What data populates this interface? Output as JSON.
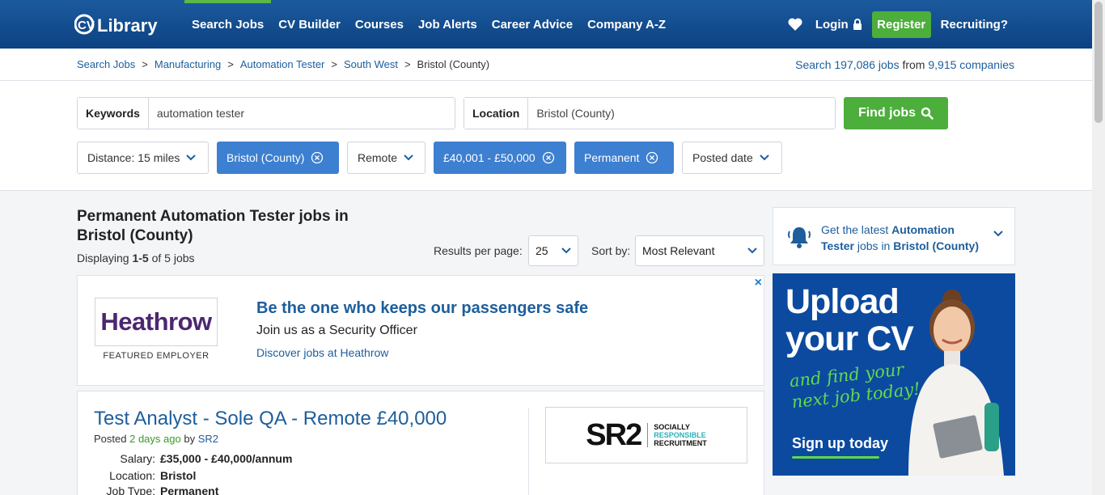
{
  "header": {
    "logo_text": "CV Library",
    "nav": [
      "Search Jobs",
      "CV Builder",
      "Courses",
      "Job Alerts",
      "Career Advice",
      "Company A-Z"
    ],
    "active_nav": 0,
    "login": "Login",
    "register": "Register",
    "recruiting": "Recruiting?"
  },
  "breadcrumb": {
    "items": [
      "Search Jobs",
      "Manufacturing",
      "Automation Tester",
      "South West"
    ],
    "current": "Bristol (County)",
    "sep": ">"
  },
  "stats": {
    "prefix": "Search",
    "jobs": "197,086 jobs",
    "mid": "from",
    "companies": "9,915 companies"
  },
  "search": {
    "keywords_label": "Keywords",
    "keywords_value": "automation tester",
    "location_label": "Location",
    "location_value": "Bristol (County)",
    "find_button": "Find jobs"
  },
  "filters": {
    "distance": "Distance: 15 miles",
    "location": "Bristol (County)",
    "remote": "Remote",
    "salary": "£40,001 - £50,000",
    "type": "Permanent",
    "posted": "Posted date"
  },
  "results": {
    "title": "Permanent Automation Tester jobs in Bristol (County)",
    "displaying_prefix": "Displaying",
    "range": "1-5",
    "displaying_suffix": "of 5 jobs",
    "per_page_label": "Results per page:",
    "per_page": "25",
    "sort_label": "Sort by:",
    "sort": "Most Relevant"
  },
  "featured": {
    "logo": "Heathrow",
    "tag": "FEATURED EMPLOYER",
    "headline": "Be the one who keeps our passengers safe",
    "subline": "Join us as a Security Officer",
    "link": "Discover jobs at Heathrow",
    "close": "×"
  },
  "job": {
    "title": "Test Analyst - Sole QA - Remote £40,000",
    "posted_prefix": "Posted",
    "posted_when": "2 days ago",
    "posted_by": "by",
    "company": "SR2",
    "salary_label": "Salary:",
    "salary": "£35,000 - £40,000/annum",
    "location_label": "Location:",
    "location": "Bristol",
    "type_label": "Job Type:",
    "type": "Permanent",
    "logo_big": "SR2",
    "logo_line1": "SOCIALLY",
    "logo_line2": "RESPONSIBLE",
    "logo_line3": "RECRUITMENT"
  },
  "alert": {
    "prefix": "Get the latest",
    "role": "Automation Tester",
    "mid": "jobs in",
    "place": "Bristol (County)"
  },
  "ad": {
    "line1": "Upload",
    "line2": "your CV",
    "script1": "and find your",
    "script2": "next job today!",
    "cta": "Sign up today"
  },
  "colors": {
    "brand": "#0d4282",
    "accent": "#4cae3b",
    "link": "#1d5e9c",
    "chip_active": "#3d7fd0"
  }
}
